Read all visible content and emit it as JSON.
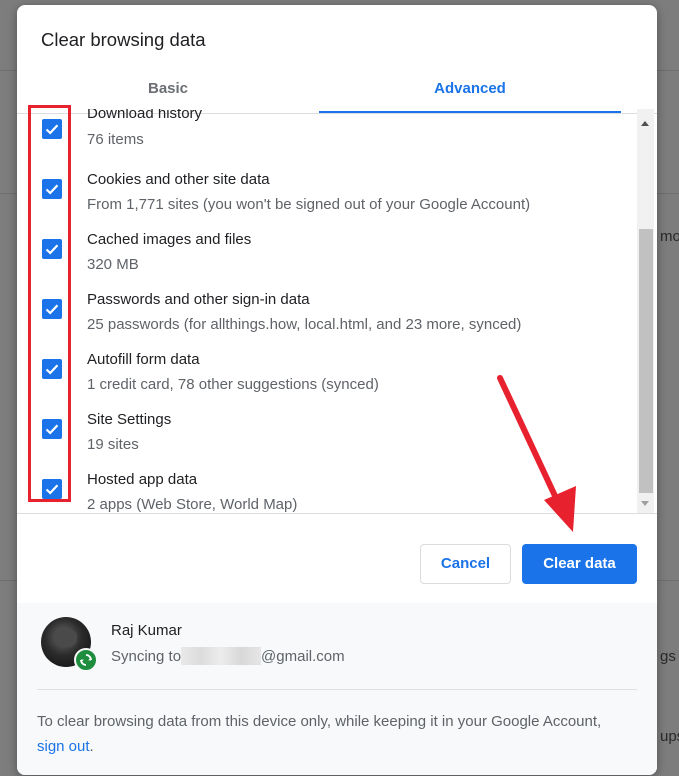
{
  "dialog": {
    "title": "Clear browsing data",
    "tabs": [
      {
        "label": "Basic",
        "active": false
      },
      {
        "label": "Advanced",
        "active": true
      }
    ]
  },
  "items": [
    {
      "label": "Download history",
      "detail": "76 items",
      "checked": true
    },
    {
      "label": "Cookies and other site data",
      "detail": "From 1,771 sites (you won't be signed out of your Google Account)",
      "checked": true
    },
    {
      "label": "Cached images and files",
      "detail": "320 MB",
      "checked": true
    },
    {
      "label": "Passwords and other sign-in data",
      "detail": "25 passwords (for allthings.how, local.html, and 23 more, synced)",
      "checked": true
    },
    {
      "label": "Autofill form data",
      "detail": "1 credit card, 78 other suggestions (synced)",
      "checked": true
    },
    {
      "label": "Site Settings",
      "detail": "19 sites",
      "checked": true
    },
    {
      "label": "Hosted app data",
      "detail": "2 apps (Web Store, World Map)",
      "checked": true
    }
  ],
  "buttons": {
    "cancel": "Cancel",
    "clear": "Clear data"
  },
  "account": {
    "name": "Raj Kumar",
    "sync_prefix": "Syncing to",
    "sync_suffix": "@gmail.com"
  },
  "footer": {
    "note_before": "To clear browsing data from this device only, while keeping it in your Google Account, ",
    "link": "sign out",
    "note_after": "."
  },
  "background": {
    "fragments": [
      "mor",
      "gs",
      "ups"
    ]
  },
  "colors": {
    "accent": "#1a73e8",
    "annotation_red": "#e8212e",
    "sync_green": "#1e8e3e"
  },
  "icons": [
    "checkbox-check-icon",
    "scroll-up-arrow-icon",
    "scroll-down-arrow-icon",
    "sync-icon",
    "avatar-image"
  ]
}
